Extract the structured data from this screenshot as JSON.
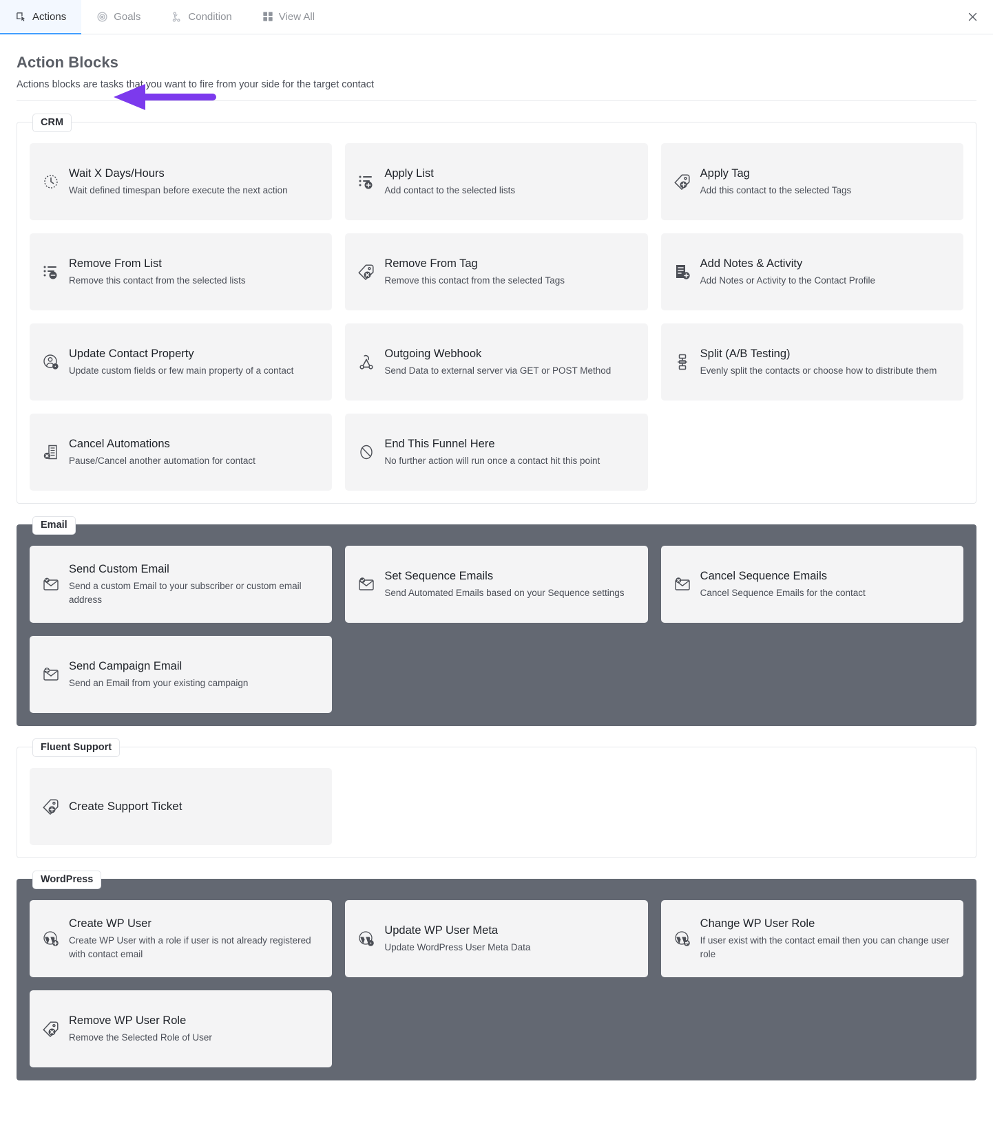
{
  "tabs": [
    {
      "label": "Actions",
      "icon": "actions-icon",
      "active": true
    },
    {
      "label": "Goals",
      "icon": "goals-icon",
      "active": false
    },
    {
      "label": "Condition",
      "icon": "condition-icon",
      "active": false
    },
    {
      "label": "View All",
      "icon": "grid-icon",
      "active": false
    }
  ],
  "close_label": "×",
  "header": {
    "title": "Action Blocks",
    "subtitle": "Actions blocks are tasks that you want to fire from your side for the target contact",
    "annotation_color": "#7c3aed"
  },
  "colors": {
    "dark_section_bg": "#636872",
    "card_bg": "#f4f4f5",
    "accent": "#409eff",
    "arrow_purple": "#7c3aed"
  },
  "sections": [
    {
      "legend": "CRM",
      "dark": false,
      "cards": [
        {
          "title": "Wait X Days/Hours",
          "desc": "Wait defined timespan before execute the next action",
          "icon": "clock-icon"
        },
        {
          "title": "Apply List",
          "desc": "Add contact to the selected lists",
          "icon": "list-add-icon"
        },
        {
          "title": "Apply Tag",
          "desc": "Add this contact to the selected Tags",
          "icon": "tag-add-icon"
        },
        {
          "title": "Remove From List",
          "desc": "Remove this contact from the selected lists",
          "icon": "list-remove-icon"
        },
        {
          "title": "Remove From Tag",
          "desc": "Remove this contact from the selected Tags",
          "icon": "tag-remove-icon"
        },
        {
          "title": "Add Notes & Activity",
          "desc": "Add Notes or Activity to the Contact Profile",
          "icon": "note-add-icon"
        },
        {
          "title": "Update Contact Property",
          "desc": "Update custom fields or few main property of a contact",
          "icon": "user-edit-icon"
        },
        {
          "title": "Outgoing Webhook",
          "desc": "Send Data to external server via GET or POST Method",
          "icon": "webhook-icon"
        },
        {
          "title": "Split (A/B Testing)",
          "desc": "Evenly split the contacts or choose how to distribute them",
          "icon": "split-icon"
        },
        {
          "title": "Cancel Automations",
          "desc": "Pause/Cancel another automation for contact",
          "icon": "cancel-automation-icon"
        },
        {
          "title": "End This Funnel Here",
          "desc": "No further action will run once a contact hit this point",
          "icon": "ban-icon"
        }
      ]
    },
    {
      "legend": "Email",
      "dark": true,
      "cards": [
        {
          "title": "Send Custom Email",
          "desc": "Send a custom Email to your subscriber or custom email address",
          "icon": "email-custom-icon"
        },
        {
          "title": "Set Sequence Emails",
          "desc": "Send Automated Emails based on your Sequence settings",
          "icon": "email-check-icon"
        },
        {
          "title": "Cancel Sequence Emails",
          "desc": "Cancel Sequence Emails for the contact",
          "icon": "email-cancel-icon"
        },
        {
          "title": "Send Campaign Email",
          "desc": "Send an Email from your existing campaign",
          "icon": "email-campaign-icon"
        }
      ]
    },
    {
      "legend": "Fluent Support",
      "dark": false,
      "cards": [
        {
          "title": "Create Support Ticket",
          "desc": "",
          "icon": "tag-add-icon"
        }
      ]
    },
    {
      "legend": "WordPress",
      "dark": true,
      "cards": [
        {
          "title": "Create WP User",
          "desc": "Create WP User with a role if user is not already registered with contact email",
          "icon": "wp-add-icon"
        },
        {
          "title": "Update WP User Meta",
          "desc": "Update WordPress User Meta Data",
          "icon": "wp-edit-icon"
        },
        {
          "title": "Change WP User Role",
          "desc": "If user exist with the contact email then you can change user role",
          "icon": "wp-swap-icon"
        },
        {
          "title": "Remove WP User Role",
          "desc": "Remove the Selected Role of User",
          "icon": "tag-remove-icon"
        }
      ]
    }
  ]
}
